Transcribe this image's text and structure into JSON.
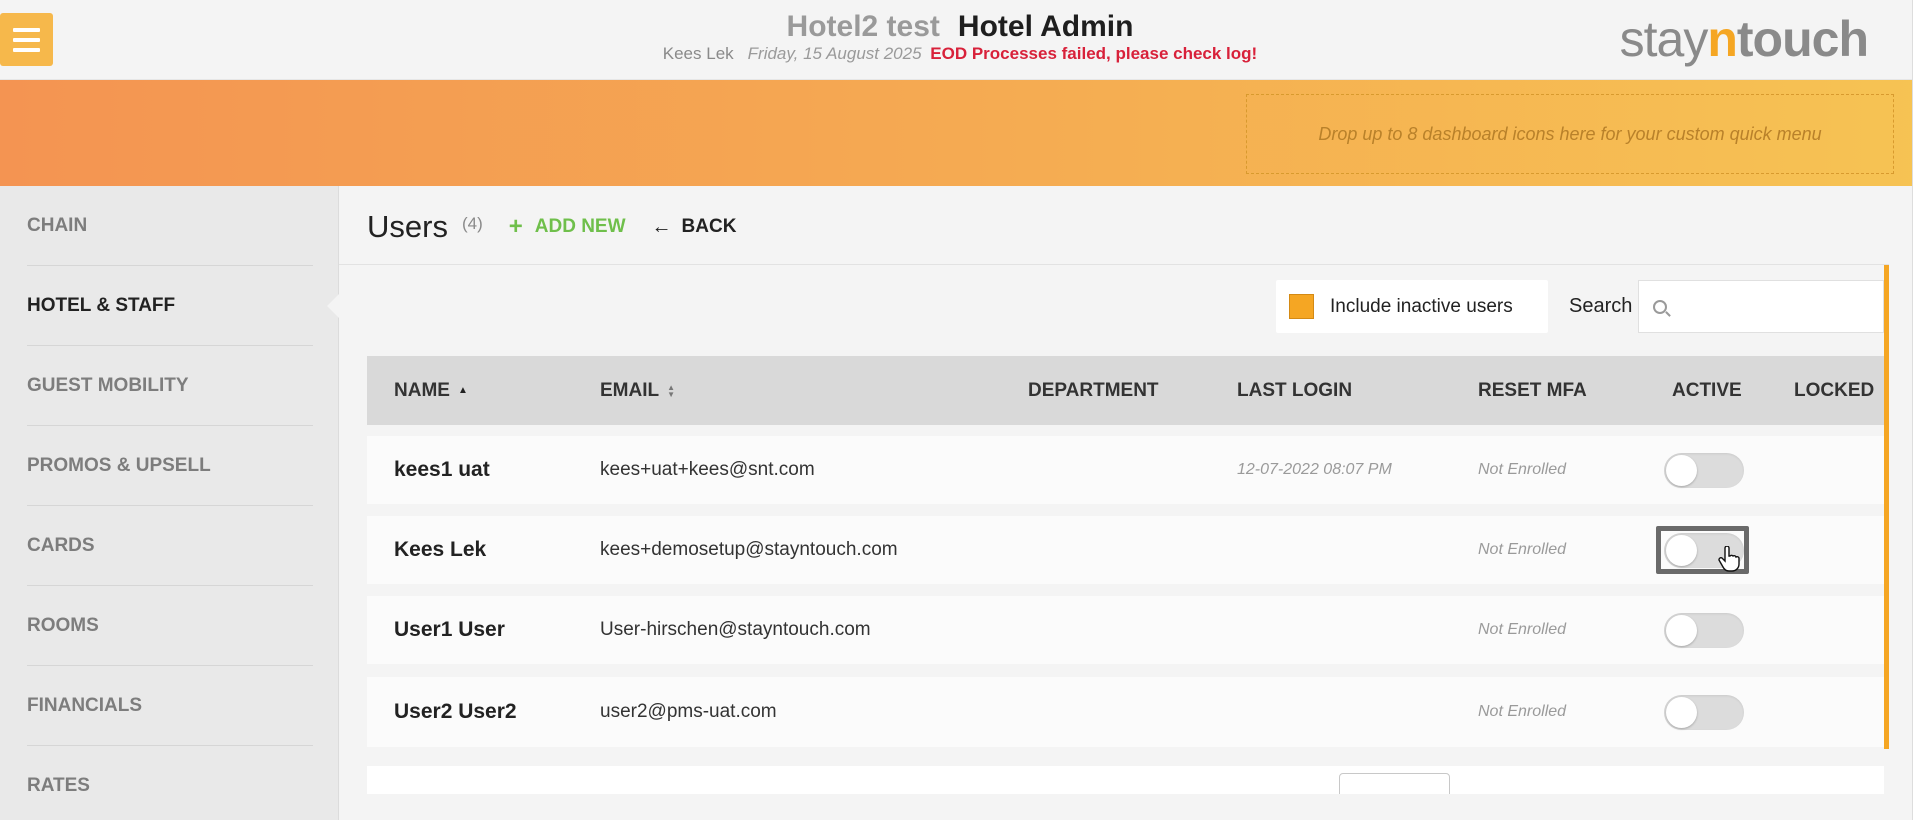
{
  "header": {
    "hotel_name": "Hotel2 test",
    "app_name": "Hotel Admin",
    "user_name": "Kees Lek",
    "date": "Friday, 15 August 2025",
    "error": "EOD Processes failed, please check log!",
    "logo_stay": "stay",
    "logo_n": "n",
    "logo_touch": "touch"
  },
  "banner": {
    "dropzone_text": "Drop up to 8 dashboard icons here for your custom quick menu"
  },
  "sidebar": {
    "items": [
      {
        "label": "CHAIN",
        "active": false
      },
      {
        "label": "HOTEL & STAFF",
        "active": true
      },
      {
        "label": "GUEST MOBILITY",
        "active": false
      },
      {
        "label": "PROMOS & UPSELL",
        "active": false
      },
      {
        "label": "CARDS",
        "active": false
      },
      {
        "label": "ROOMS",
        "active": false
      },
      {
        "label": "FINANCIALS",
        "active": false
      },
      {
        "label": "RATES",
        "active": false
      }
    ]
  },
  "main": {
    "title": "Users",
    "count": "(4)",
    "add_new": "ADD NEW",
    "back": "BACK",
    "include_inactive_label": "Include inactive users",
    "search_label": "Search",
    "search_placeholder": "",
    "accent_color": "#f5a623"
  },
  "table": {
    "columns": [
      "NAME",
      "EMAIL",
      "DEPARTMENT",
      "LAST LOGIN",
      "RESET MFA",
      "ACTIVE",
      "LOCKED"
    ],
    "rows": [
      {
        "name": "kees1 uat",
        "email": "kees+uat+kees@snt.com",
        "department": "",
        "last_login": "12-07-2022 08:07 PM",
        "reset_mfa": "Not Enrolled",
        "active": false
      },
      {
        "name": "Kees Lek",
        "email": "kees+demosetup@stayntouch.com",
        "department": "",
        "last_login": "",
        "reset_mfa": "Not Enrolled",
        "active": false
      },
      {
        "name": "User1 User",
        "email": "User-hirschen@stayntouch.com",
        "department": "",
        "last_login": "",
        "reset_mfa": "Not Enrolled",
        "active": false
      },
      {
        "name": "User2 User2",
        "email": "user2@pms-uat.com",
        "department": "",
        "last_login": "",
        "reset_mfa": "Not Enrolled",
        "active": false
      }
    ]
  }
}
